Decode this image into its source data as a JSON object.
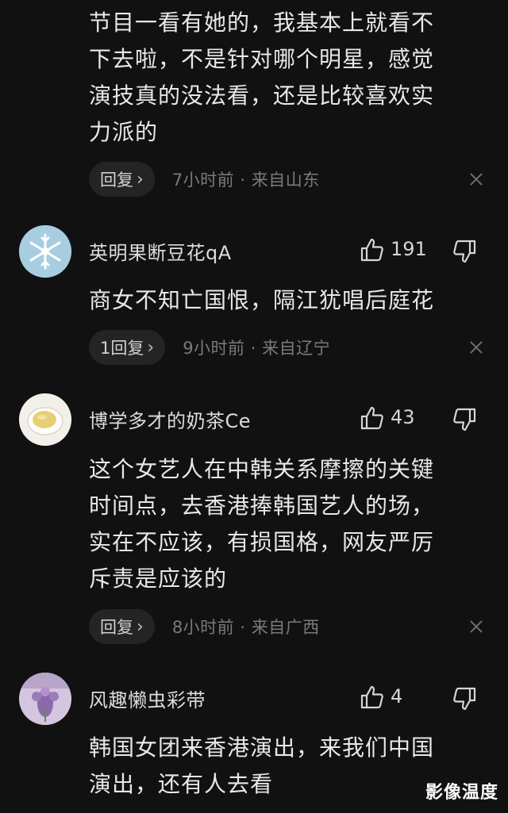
{
  "comments": [
    {
      "text_lines": [
        "节目一看有她的，我基本上就看不",
        "下去啦，不是针对哪个明星，感觉",
        "演技真的没法看，还是比较喜欢实",
        "力派的"
      ],
      "reply_label": "回复",
      "meta": "7小时前 · 来自山东"
    },
    {
      "username": "英明果断豆花qA",
      "avatar_icon": "snowflake-avatar",
      "likes": "191",
      "text_lines": [
        "商女不知亡国恨，隔江犹唱后庭花"
      ],
      "reply_label": "1回复",
      "meta": "9小时前 · 来自辽宁"
    },
    {
      "username": "博学多才的奶茶Ce",
      "avatar_icon": "tea-cup-avatar",
      "likes": "43",
      "text_lines": [
        "这个女艺人在中韩关系摩擦的关键",
        "时间点，去香港捧韩国艺人的场，",
        "实在不应该，有损国格，网友严厉",
        "斥责是应该的"
      ],
      "reply_label": "回复",
      "meta": "8小时前 · 来自广西"
    },
    {
      "username": "风趣懒虫彩带",
      "avatar_icon": "flower-avatar",
      "likes": "4",
      "text_lines": [
        "韩国女团来香港演出，来我们中国",
        "演出，还有人去看"
      ]
    }
  ],
  "watermark": "影像温度",
  "colors": {
    "background": "#111111",
    "pill": "#242424",
    "meta_text": "#7a7a7a"
  }
}
